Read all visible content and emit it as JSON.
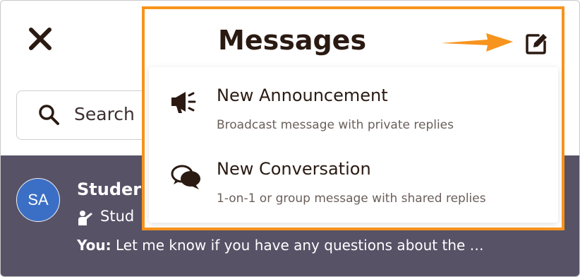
{
  "background_list": {
    "search": {
      "placeholder": "Search"
    },
    "conversation": {
      "avatar_initials": "SA",
      "name": "Studer",
      "role": "Stud",
      "preview_prefix": "You:",
      "preview_text": "Let me know if you have any questions about the …"
    }
  },
  "popup": {
    "title": "Messages",
    "compose_icon": "compose-icon",
    "highlight_color": "#f7941d",
    "items": [
      {
        "icon": "megaphone-icon",
        "title": "New Announcement",
        "subtitle": "Broadcast message with private replies"
      },
      {
        "icon": "chat-bubbles-icon",
        "title": "New Conversation",
        "subtitle": "1-on-1 or group message with shared replies"
      }
    ]
  },
  "colors": {
    "accent": "#f7941d",
    "dark_band": "#575266",
    "avatar": "#3b6fc6",
    "text": "#2a1a12"
  }
}
